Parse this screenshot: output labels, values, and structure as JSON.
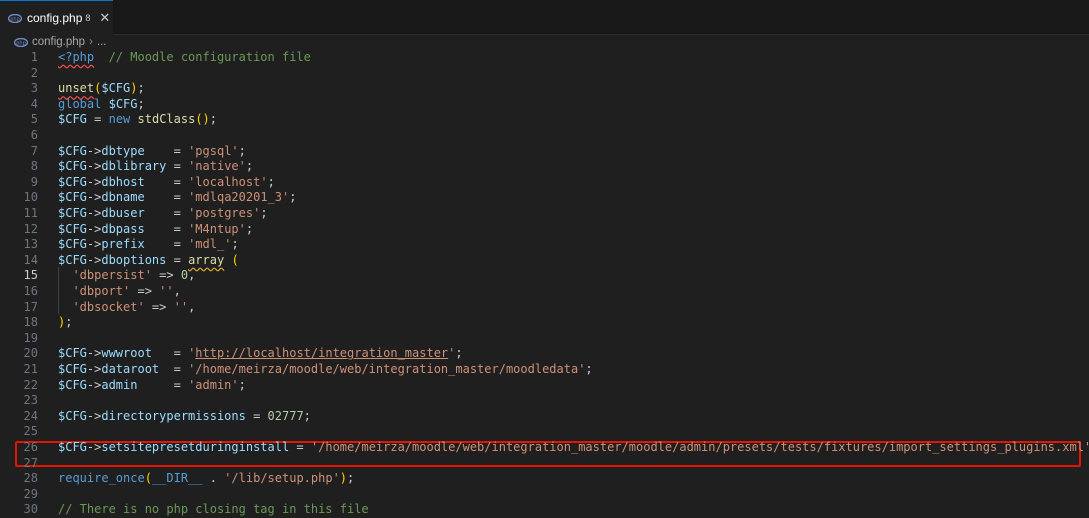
{
  "tab": {
    "label": "config.php",
    "badge": "8"
  },
  "breadcrumb": {
    "file": "config.php",
    "separator": "›",
    "more": "..."
  },
  "colors": {
    "plain": "#cccccc",
    "variable": "#9cdcfe",
    "keyword": "#569cd6",
    "string": "#ce9178",
    "comment": "#6a9955",
    "function": "#dcdcaa",
    "number": "#b5cea8",
    "bracket": "#ffd700",
    "tag": "#569cd6"
  },
  "lines": [
    {
      "n": "1",
      "tokens": [
        [
          "<?php",
          "tag",
          "squiggle-red"
        ],
        [
          "  ",
          "plain"
        ],
        [
          "// Moodle configuration file",
          "comment"
        ]
      ]
    },
    {
      "n": "2",
      "tokens": []
    },
    {
      "n": "3",
      "tokens": [
        [
          "unset",
          "function",
          "squiggle-red"
        ],
        [
          "(",
          "bracket"
        ],
        [
          "$CFG",
          "variable"
        ],
        [
          ")",
          "bracket"
        ],
        [
          ";",
          "plain"
        ]
      ]
    },
    {
      "n": "4",
      "tokens": [
        [
          "global",
          "keyword"
        ],
        [
          " ",
          "plain"
        ],
        [
          "$CFG",
          "variable"
        ],
        [
          ";",
          "plain"
        ]
      ]
    },
    {
      "n": "5",
      "tokens": [
        [
          "$CFG",
          "variable"
        ],
        [
          " = ",
          "plain"
        ],
        [
          "new",
          "keyword"
        ],
        [
          " ",
          "plain"
        ],
        [
          "stdClass",
          "function"
        ],
        [
          "()",
          "bracket"
        ],
        [
          ";",
          "plain"
        ]
      ]
    },
    {
      "n": "6",
      "tokens": []
    },
    {
      "n": "7",
      "tokens": [
        [
          "$CFG",
          "variable"
        ],
        [
          "->",
          "plain"
        ],
        [
          "dbtype",
          "variable"
        ],
        [
          "    = ",
          "plain"
        ],
        [
          "'pgsql'",
          "string"
        ],
        [
          ";",
          "plain"
        ]
      ]
    },
    {
      "n": "8",
      "tokens": [
        [
          "$CFG",
          "variable"
        ],
        [
          "->",
          "plain"
        ],
        [
          "dblibrary",
          "variable"
        ],
        [
          " = ",
          "plain"
        ],
        [
          "'native'",
          "string"
        ],
        [
          ";",
          "plain"
        ]
      ]
    },
    {
      "n": "9",
      "tokens": [
        [
          "$CFG",
          "variable"
        ],
        [
          "->",
          "plain"
        ],
        [
          "dbhost",
          "variable"
        ],
        [
          "    = ",
          "plain"
        ],
        [
          "'localhost'",
          "string"
        ],
        [
          ";",
          "plain"
        ]
      ]
    },
    {
      "n": "10",
      "tokens": [
        [
          "$CFG",
          "variable"
        ],
        [
          "->",
          "plain"
        ],
        [
          "dbname",
          "variable"
        ],
        [
          "    = ",
          "plain"
        ],
        [
          "'mdlqa20201_3'",
          "string"
        ],
        [
          ";",
          "plain"
        ]
      ]
    },
    {
      "n": "11",
      "tokens": [
        [
          "$CFG",
          "variable"
        ],
        [
          "->",
          "plain"
        ],
        [
          "dbuser",
          "variable"
        ],
        [
          "    = ",
          "plain"
        ],
        [
          "'postgres'",
          "string"
        ],
        [
          ";",
          "plain"
        ]
      ]
    },
    {
      "n": "12",
      "tokens": [
        [
          "$CFG",
          "variable"
        ],
        [
          "->",
          "plain"
        ],
        [
          "dbpass",
          "variable"
        ],
        [
          "    = ",
          "plain"
        ],
        [
          "'M4ntup'",
          "string"
        ],
        [
          ";",
          "plain"
        ]
      ]
    },
    {
      "n": "13",
      "tokens": [
        [
          "$CFG",
          "variable"
        ],
        [
          "->",
          "plain"
        ],
        [
          "prefix",
          "variable"
        ],
        [
          "    = ",
          "plain"
        ],
        [
          "'mdl_'",
          "string"
        ],
        [
          ";",
          "plain"
        ]
      ]
    },
    {
      "n": "14",
      "tokens": [
        [
          "$CFG",
          "variable"
        ],
        [
          "->",
          "plain"
        ],
        [
          "dboptions",
          "variable"
        ],
        [
          " = ",
          "plain"
        ],
        [
          "array",
          "function",
          "squiggle"
        ],
        [
          " ",
          "plain"
        ],
        [
          "(",
          "bracket"
        ]
      ]
    },
    {
      "n": "15",
      "active": true,
      "tokens": [
        [
          "  ",
          "plain"
        ],
        [
          "'dbpersist'",
          "string"
        ],
        [
          " => ",
          "plain"
        ],
        [
          "0",
          "number"
        ],
        [
          ",",
          "plain"
        ]
      ]
    },
    {
      "n": "16",
      "tokens": [
        [
          "  ",
          "plain"
        ],
        [
          "'dbport'",
          "string"
        ],
        [
          " => ",
          "plain"
        ],
        [
          "''",
          "string"
        ],
        [
          ",",
          "plain"
        ]
      ]
    },
    {
      "n": "17",
      "tokens": [
        [
          "  ",
          "plain"
        ],
        [
          "'dbsocket'",
          "string"
        ],
        [
          " => ",
          "plain"
        ],
        [
          "''",
          "string"
        ],
        [
          ",",
          "plain"
        ]
      ]
    },
    {
      "n": "18",
      "tokens": [
        [
          ")",
          "bracket"
        ],
        [
          ";",
          "plain"
        ]
      ]
    },
    {
      "n": "19",
      "tokens": []
    },
    {
      "n": "20",
      "tokens": [
        [
          "$CFG",
          "variable"
        ],
        [
          "->",
          "plain"
        ],
        [
          "wwwroot",
          "variable"
        ],
        [
          "   = ",
          "plain"
        ],
        [
          "'",
          "string"
        ],
        [
          "http://localhost/integration_master",
          "string",
          "link"
        ],
        [
          "'",
          "string"
        ],
        [
          ";",
          "plain"
        ]
      ]
    },
    {
      "n": "21",
      "tokens": [
        [
          "$CFG",
          "variable"
        ],
        [
          "->",
          "plain"
        ],
        [
          "dataroot",
          "variable"
        ],
        [
          "  = ",
          "plain"
        ],
        [
          "'/home/meirza/moodle/web/integration_master/moodledata'",
          "string"
        ],
        [
          ";",
          "plain"
        ]
      ]
    },
    {
      "n": "22",
      "tokens": [
        [
          "$CFG",
          "variable"
        ],
        [
          "->",
          "plain"
        ],
        [
          "admin",
          "variable"
        ],
        [
          "     = ",
          "plain"
        ],
        [
          "'admin'",
          "string"
        ],
        [
          ";",
          "plain"
        ]
      ]
    },
    {
      "n": "23",
      "tokens": []
    },
    {
      "n": "24",
      "tokens": [
        [
          "$CFG",
          "variable"
        ],
        [
          "->",
          "plain"
        ],
        [
          "directorypermissions",
          "variable"
        ],
        [
          " = ",
          "plain"
        ],
        [
          "02777",
          "number"
        ],
        [
          ";",
          "plain"
        ]
      ]
    },
    {
      "n": "25",
      "tokens": []
    },
    {
      "n": "26",
      "tokens": [
        [
          "$CFG",
          "variable"
        ],
        [
          "->",
          "plain"
        ],
        [
          "setsitepresetduringinstall",
          "variable"
        ],
        [
          " = ",
          "plain"
        ],
        [
          "'/home/meirza/moodle/web/integration_master/moodle/admin/presets/tests/fixtures/import_settings_plugins.xml'",
          "string"
        ],
        [
          ";",
          "plain",
          "squiggle"
        ]
      ]
    },
    {
      "n": "27",
      "tokens": []
    },
    {
      "n": "28",
      "tokens": [
        [
          "require_once",
          "keyword"
        ],
        [
          "(",
          "bracket"
        ],
        [
          "__DIR__",
          "keyword"
        ],
        [
          " . ",
          "plain"
        ],
        [
          "'/lib/setup.php'",
          "string"
        ],
        [
          ")",
          "bracket"
        ],
        [
          ";",
          "plain"
        ]
      ]
    },
    {
      "n": "29",
      "tokens": []
    },
    {
      "n": "30",
      "tokens": [
        [
          "// There is no php closing tag in this file",
          "comment"
        ]
      ]
    }
  ]
}
